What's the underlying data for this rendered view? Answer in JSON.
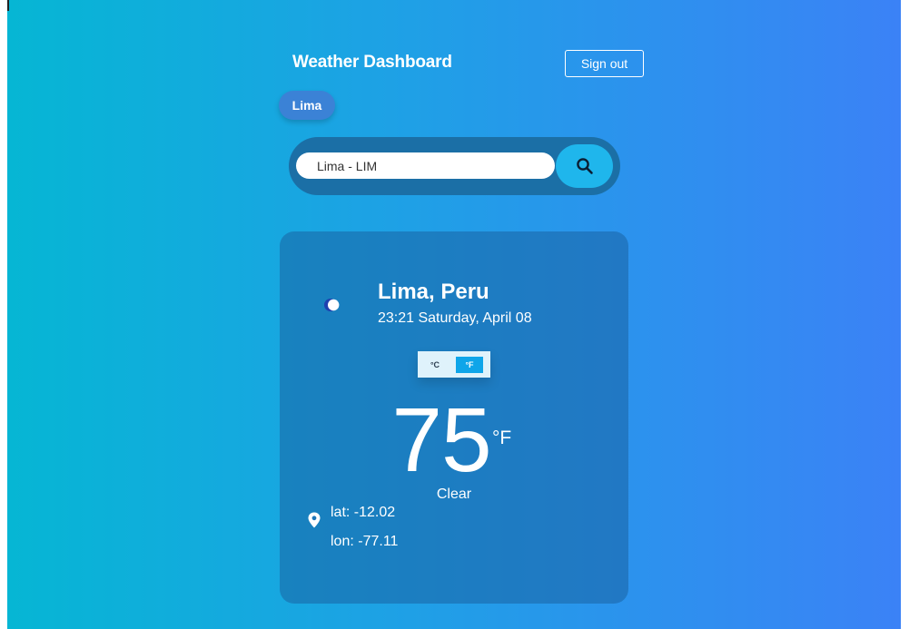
{
  "header": {
    "title": "Weather Dashboard",
    "signout_label": "Sign out"
  },
  "chips": [
    {
      "label": "Lima"
    }
  ],
  "search": {
    "value": "Lima - LIM",
    "button_icon": "search-icon"
  },
  "weather": {
    "location": "Lima, Peru",
    "datetime": "23:21 Saturday, April 08",
    "icon": "moon-icon",
    "unit_toggle": {
      "celsius_label": "°C",
      "fahrenheit_label": "°F",
      "selected": "°F"
    },
    "temperature": "75",
    "temperature_unit": "°F",
    "condition": "Clear",
    "lat": "lat: -12.02",
    "lon": "lon: -77.11"
  },
  "colors": {
    "gradient_start": "#06b6d4",
    "gradient_end": "#3b82f6",
    "search_button": "#1fb6ec",
    "toggle_active": "#0ea5e9"
  }
}
